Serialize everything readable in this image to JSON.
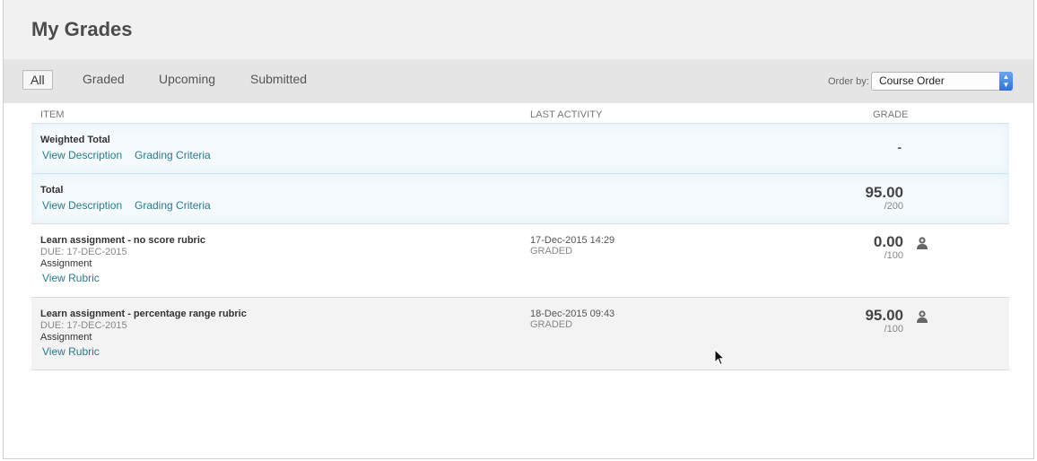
{
  "page": {
    "title": "My Grades"
  },
  "filters": [
    {
      "label": "All",
      "active": true
    },
    {
      "label": "Graded",
      "active": false
    },
    {
      "label": "Upcoming",
      "active": false
    },
    {
      "label": "Submitted",
      "active": false
    }
  ],
  "order": {
    "label": "Order by:",
    "value": "Course Order"
  },
  "columns": {
    "item": "ITEM",
    "last_activity": "LAST ACTIVITY",
    "grade": "GRADE"
  },
  "totals": [
    {
      "name": "Weighted Total",
      "view_description": "View Description",
      "grading_criteria": "Grading Criteria",
      "grade": "-"
    },
    {
      "name": "Total",
      "view_description": "View Description",
      "grading_criteria": "Grading Criteria",
      "score": "95.00",
      "out_of": "/200"
    }
  ],
  "items": [
    {
      "name": "Learn assignment - no score rubric",
      "due": "DUE: 17-DEC-2015",
      "type": "Assignment",
      "link": "View Rubric",
      "activity_date": "17-Dec-2015 14:29",
      "activity_status": "GRADED",
      "score": "0.00",
      "out_of": "/100",
      "icon": "user-icon"
    },
    {
      "name": "Learn assignment - percentage range rubric",
      "due": "DUE: 17-DEC-2015",
      "type": "Assignment",
      "link": "View Rubric",
      "activity_date": "18-Dec-2015 09:43",
      "activity_status": "GRADED",
      "score": "95.00",
      "out_of": "/100",
      "icon": "user-icon"
    }
  ]
}
